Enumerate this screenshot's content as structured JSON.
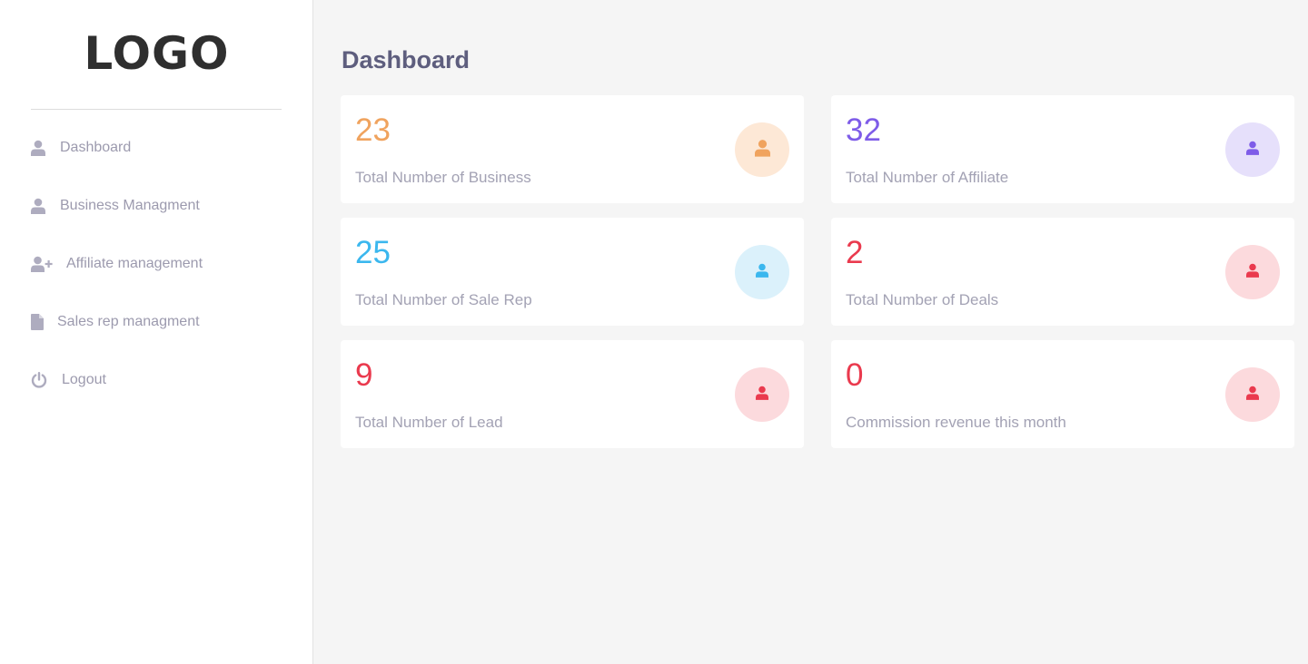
{
  "sidebar": {
    "logo": "LOGO",
    "items": [
      {
        "label": "Dashboard",
        "icon": "user-icon"
      },
      {
        "label": "Business Managment",
        "icon": "user-icon"
      },
      {
        "label": "Affiliate management",
        "icon": "user-plus-icon"
      },
      {
        "label": "Sales rep managment",
        "icon": "file-icon"
      },
      {
        "label": "Logout",
        "icon": "power-icon"
      }
    ]
  },
  "main": {
    "title": "Dashboard",
    "cards": [
      {
        "value": "23",
        "label": "Total Number of Business",
        "color": "#f0a35e",
        "badge_bg": "#fde8d6",
        "icon": "user-icon"
      },
      {
        "value": "32",
        "label": "Total Number of Affiliate",
        "color": "#7e5ce8",
        "badge_bg": "#e6e0fb",
        "icon": "user-icon"
      },
      {
        "value": "25",
        "label": "Total Number of Sale Rep",
        "color": "#3bb7ee",
        "badge_bg": "#dbf1fb",
        "icon": "user-icon"
      },
      {
        "value": "2",
        "label": "Total Number of Deals",
        "color": "#ea3a4e",
        "badge_bg": "#fcdadd",
        "icon": "user-icon"
      },
      {
        "value": "9",
        "label": "Total Number of Lead",
        "color": "#ea3a4e",
        "badge_bg": "#fcdadd",
        "icon": "user-icon"
      },
      {
        "value": "0",
        "label": "Commission revenue this month",
        "color": "#ea3a4e",
        "badge_bg": "#fcdadd",
        "icon": "user-icon"
      }
    ]
  }
}
